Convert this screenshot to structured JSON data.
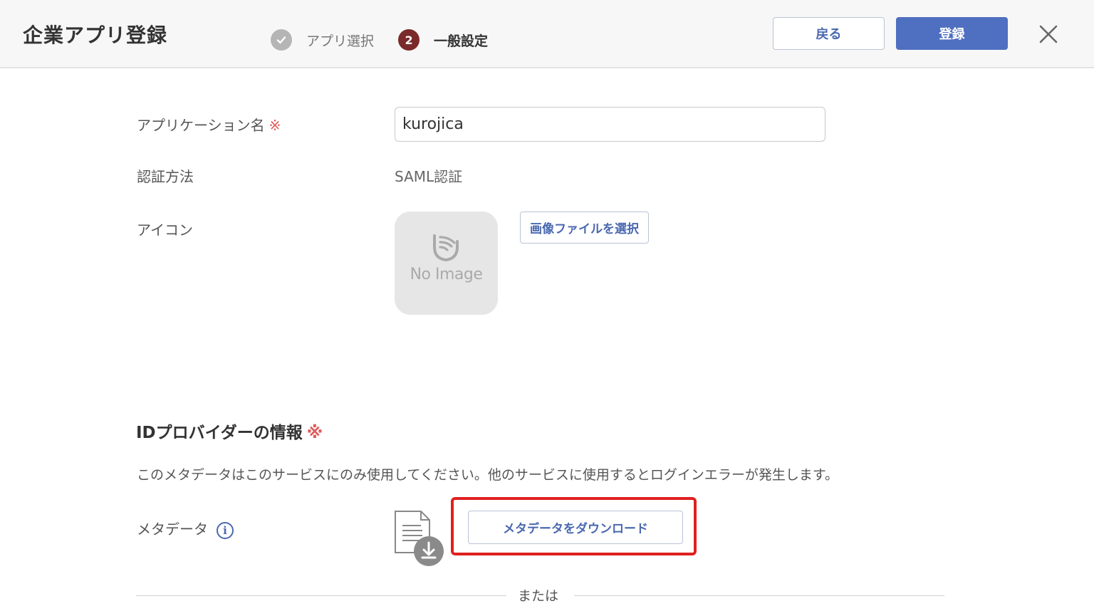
{
  "header": {
    "title": "企業アプリ登録",
    "steps": [
      {
        "number": "",
        "label": "アプリ選択",
        "state": "done"
      },
      {
        "number": "2",
        "label": "一般設定",
        "state": "active"
      }
    ],
    "back_label": "戻る",
    "register_label": "登録"
  },
  "form": {
    "app_name": {
      "label": "アプリケーション名",
      "required_mark": "※",
      "value": "kurojica"
    },
    "auth_method": {
      "label": "認証方法",
      "value": "SAML認証"
    },
    "icon": {
      "label": "アイコン",
      "placeholder_text": "No Image",
      "select_button_label": "画像ファイルを選択"
    }
  },
  "idp": {
    "title": "IDプロバイダーの情報",
    "required_mark": "※",
    "notice": "このメタデータはこのサービスにのみ使用してください。他のサービスに使用するとログインエラーが発生します。",
    "metadata_label": "メタデータ",
    "info_icon_glyph": "i",
    "download_button_label": "メタデータをダウンロード",
    "or_label": "または"
  },
  "colors": {
    "accent": "#4f6fc0",
    "link": "#4a68b0",
    "active_step": "#7a2a2a",
    "highlight": "#e02020",
    "required": "#e05a5a"
  }
}
